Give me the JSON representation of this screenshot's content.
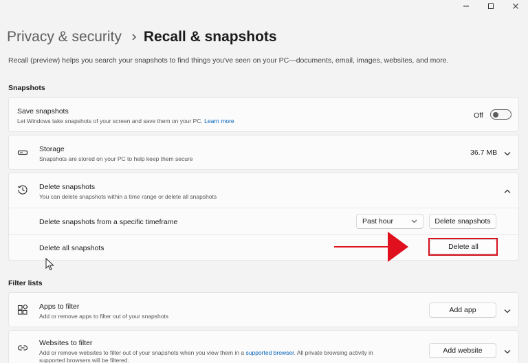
{
  "window": {
    "controls": [
      "minimize-icon",
      "maximize-icon",
      "close-icon"
    ]
  },
  "breadcrumb": {
    "parent": "Privacy & security",
    "current": "Recall & snapshots"
  },
  "intro": "Recall (preview) helps you search your snapshots to find things you've seen on your PC—documents, email, images, websites, and more.",
  "sections": {
    "snapshots": "Snapshots",
    "filter_lists": "Filter lists"
  },
  "save_snapshots": {
    "title": "Save snapshots",
    "subtitle": "Let Windows take snapshots of your screen and save them on your PC.",
    "link": "Learn more",
    "toggle_label": "Off",
    "toggle_on": false
  },
  "storage": {
    "title": "Storage",
    "subtitle": "Snapshots are stored on your PC to help keep them secure",
    "value": "36.7 MB"
  },
  "delete_snapshots": {
    "title": "Delete snapshots",
    "subtitle": "You can delete snapshots within a time range or delete all snapshots",
    "timeframe_label": "Delete snapshots from a specific timeframe",
    "timeframe_selected": "Past hour",
    "timeframe_button": "Delete snapshots",
    "all_label": "Delete all snapshots",
    "all_button": "Delete all"
  },
  "apps_filter": {
    "title": "Apps to filter",
    "subtitle": "Add or remove apps to filter out of your snapshots",
    "button": "Add app"
  },
  "websites_filter": {
    "title": "Websites to filter",
    "subtitle_1": "Add or remove websites to filter out of your snapshots when you view them in a",
    "subtitle_link": "supported browser",
    "subtitle_2": ". All private browsing activity in",
    "subtitle_3": "supported browsers will be filtered.",
    "button": "Add website"
  },
  "annotation": {
    "highlight_color": "#d6101e",
    "arrow_color": "#e0101e"
  }
}
